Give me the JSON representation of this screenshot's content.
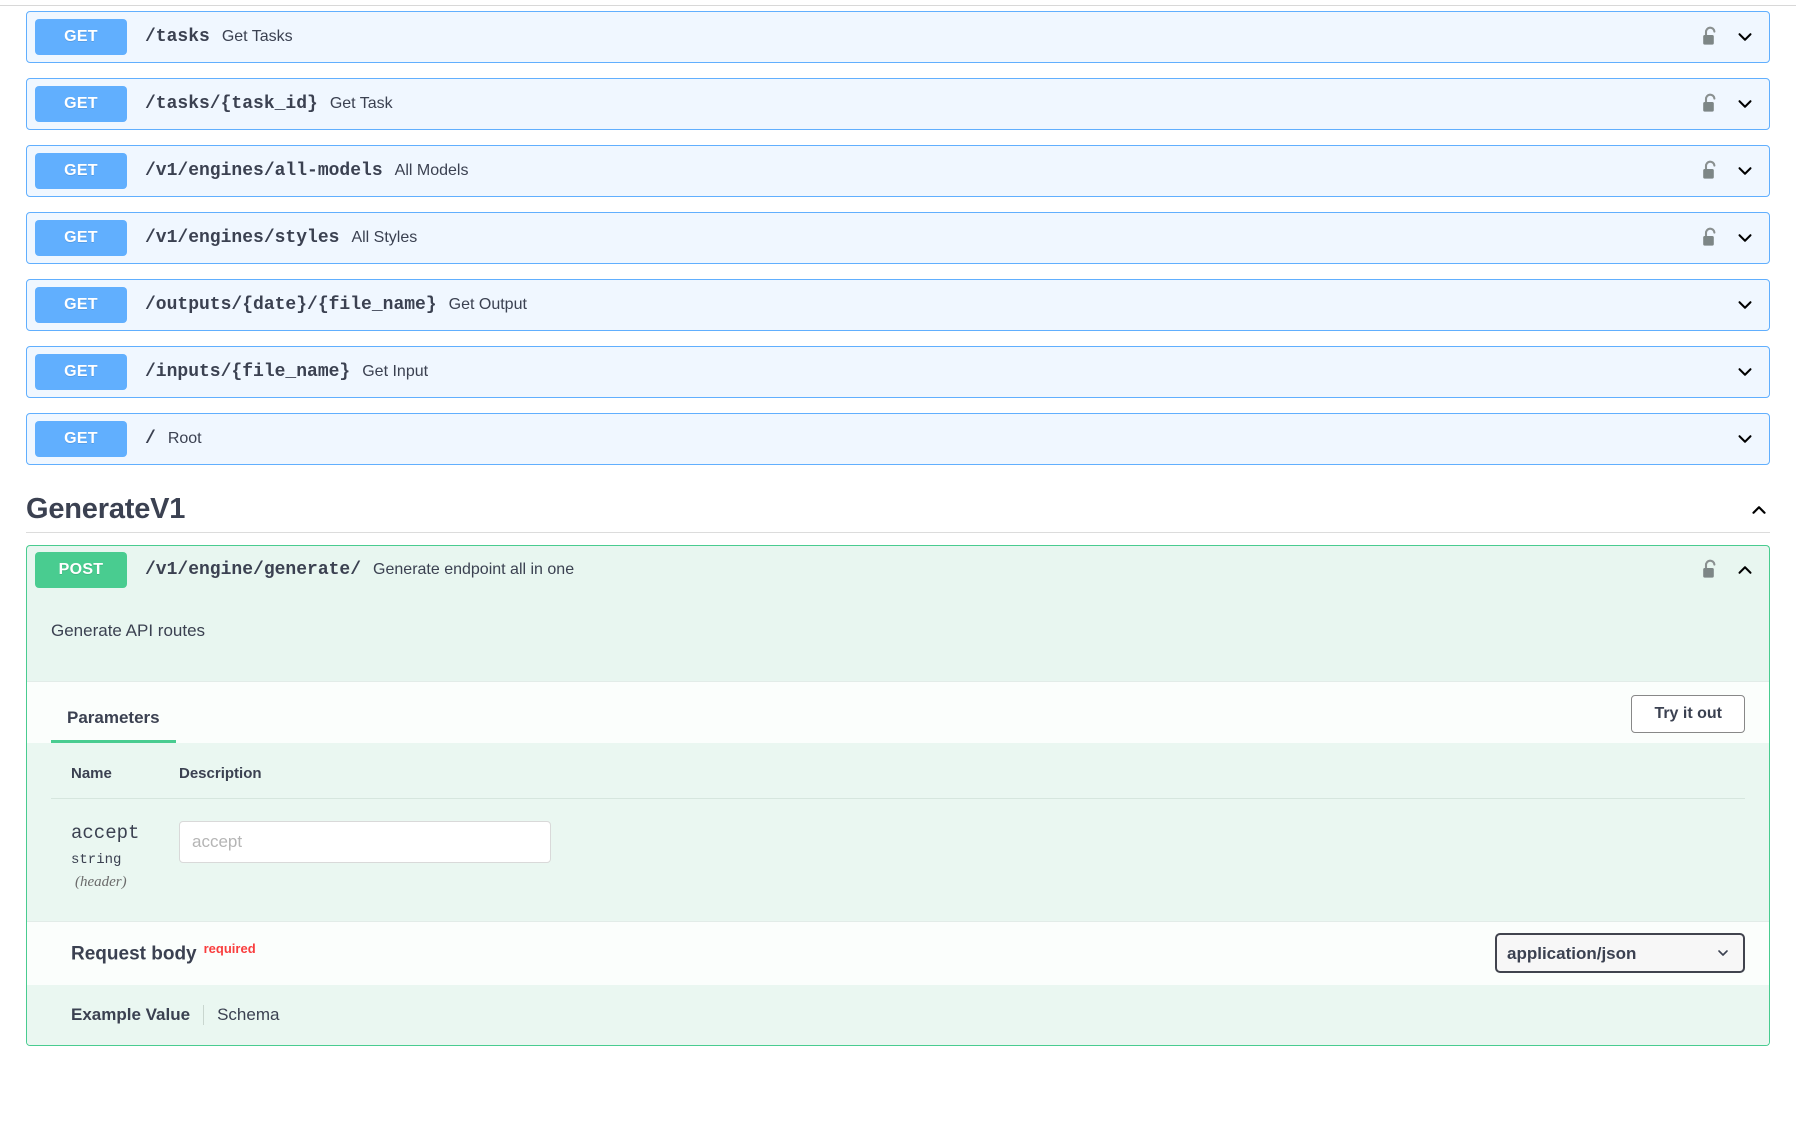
{
  "operations": [
    {
      "method": "GET",
      "path": "/tasks",
      "summary": "Get Tasks",
      "locked": true,
      "expanded": false
    },
    {
      "method": "GET",
      "path": "/tasks/{task_id}",
      "summary": "Get Task",
      "locked": true,
      "expanded": false
    },
    {
      "method": "GET",
      "path": "/v1/engines/all-models",
      "summary": "All Models",
      "locked": true,
      "expanded": false
    },
    {
      "method": "GET",
      "path": "/v1/engines/styles",
      "summary": "All Styles",
      "locked": true,
      "expanded": false
    },
    {
      "method": "GET",
      "path": "/outputs/{date}/{file_name}",
      "summary": "Get Output",
      "locked": false,
      "expanded": false
    },
    {
      "method": "GET",
      "path": "/inputs/{file_name}",
      "summary": "Get Input",
      "locked": false,
      "expanded": false
    },
    {
      "method": "GET",
      "path": "/",
      "summary": "Root",
      "locked": false,
      "expanded": false
    }
  ],
  "section": {
    "title": "GenerateV1",
    "toggle_icon": "chevron-up-icon"
  },
  "post_operation": {
    "method": "POST",
    "path": "/v1/engine/generate/",
    "summary": "Generate endpoint all in one",
    "locked": true,
    "toggle_icon": "chevron-up-icon",
    "description": "Generate API routes",
    "tabs": {
      "parameters_label": "Parameters",
      "try_it_out_label": "Try it out"
    },
    "parameters_table": {
      "headers": [
        "Name",
        "Description"
      ],
      "rows": [
        {
          "name": "accept",
          "type": "string",
          "location": "(header)",
          "description": "",
          "input_placeholder": "accept",
          "input_value": ""
        }
      ]
    },
    "request_body": {
      "label": "Request body",
      "required_badge": "required",
      "media_type_selected": "application/json",
      "media_type_options": [
        "application/json"
      ],
      "example_tabs": [
        {
          "label": "Example Value",
          "active": true
        },
        {
          "label": "Schema",
          "active": false
        }
      ]
    }
  },
  "colors": {
    "get_blue": "#61affe",
    "post_green": "#49cc90",
    "row_blue_bg": "#f0f7ff",
    "post_bg": "#e8f6f0",
    "params_bg": "#eaf7f1",
    "text": "#3b4151",
    "required_red": "#f93e3e"
  },
  "icons": {
    "lock": "unlocked-padlock-icon",
    "chevron_down": "chevron-down-icon",
    "chevron_up": "chevron-up-icon"
  }
}
